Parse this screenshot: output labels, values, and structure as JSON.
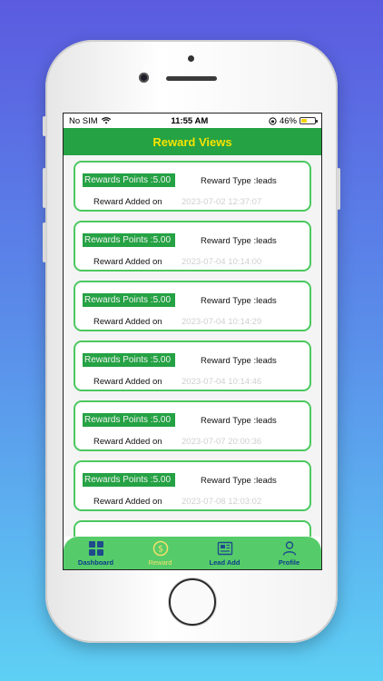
{
  "status": {
    "carrier": "No SIM",
    "time": "11:55 AM",
    "battery": "46%",
    "battery_level": 0.46
  },
  "header": {
    "title": "Reward Views"
  },
  "rewards": [
    {
      "points": "Rewards Points :5.00",
      "type": "Reward Type :leads",
      "added_label": "Reward Added on",
      "date": "2023-07-02 12:37:07"
    },
    {
      "points": "Rewards Points :5.00",
      "type": "Reward Type :leads",
      "added_label": "Reward Added on",
      "date": "2023-07-04 10:14:00"
    },
    {
      "points": "Rewards Points :5.00",
      "type": "Reward Type :leads",
      "added_label": "Reward Added on",
      "date": "2023-07-04 10:14:29"
    },
    {
      "points": "Rewards Points :5.00",
      "type": "Reward Type :leads",
      "added_label": "Reward Added on",
      "date": "2023-07-04 10:14:46"
    },
    {
      "points": "Rewards Points :5.00",
      "type": "Reward Type :leads",
      "added_label": "Reward Added on",
      "date": "2023-07-07 20:00:36"
    },
    {
      "points": "Rewards Points :5.00",
      "type": "Reward Type :leads",
      "added_label": "Reward Added on",
      "date": "2023-07-08 12:03:02"
    }
  ],
  "tabs": [
    {
      "label": "Dashboard",
      "icon": "grid-icon"
    },
    {
      "label": "Reward",
      "icon": "dollar-coin-icon",
      "active": true
    },
    {
      "label": "Lead Add",
      "icon": "newspaper-icon"
    },
    {
      "label": "Profile",
      "icon": "person-icon"
    }
  ],
  "colors": {
    "primary_green": "#25a244",
    "tab_green": "#55cc69",
    "title_yellow": "#f7e300",
    "tab_label_blue": "#0b3b8a"
  }
}
